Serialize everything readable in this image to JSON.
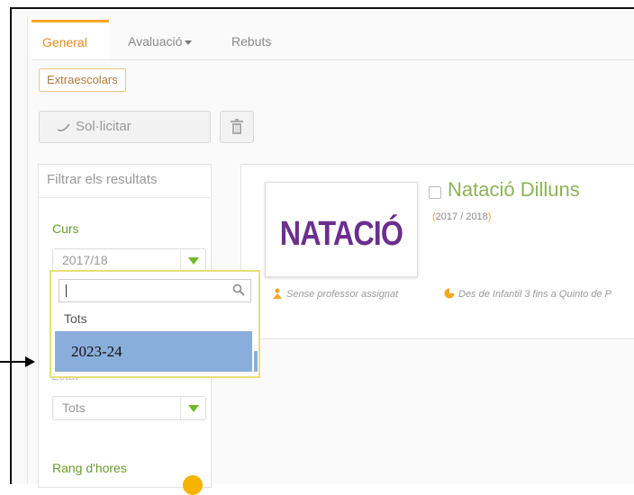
{
  "tabs": [
    {
      "label": "General",
      "active": true
    },
    {
      "label": "Avaluació",
      "has_dropdown": true
    },
    {
      "label": "Rebuts"
    }
  ],
  "subtab": {
    "label": "Extraescolars"
  },
  "toolbar": {
    "request_label": "Sol·licitar",
    "request_icon": "spinner-icon",
    "delete_icon": "trash-icon"
  },
  "filters": {
    "title": "Filtrar els resultats",
    "curs_label": "Curs",
    "curs_value": "2017/18",
    "estat_label": "Estat",
    "estat_value": "Tots",
    "rang_label": "Rang d'hores"
  },
  "dropdown": {
    "search_value": "",
    "options": [
      "Tots",
      "2023-24"
    ],
    "highlighted": "2023-24"
  },
  "course": {
    "logo_text": "NATACIÓ",
    "title": "Natació Dilluns",
    "year": "2017 / 2018",
    "year_open": "(",
    "year_close": ")",
    "teacher": "Sense professor assignat",
    "range": "Des de Infantil 3 fins a Quinto de P"
  },
  "colors": {
    "accent": "#f5a623",
    "green": "#6a9e2a",
    "purple": "#6b2f8f",
    "highlight": "#8aaedb"
  }
}
